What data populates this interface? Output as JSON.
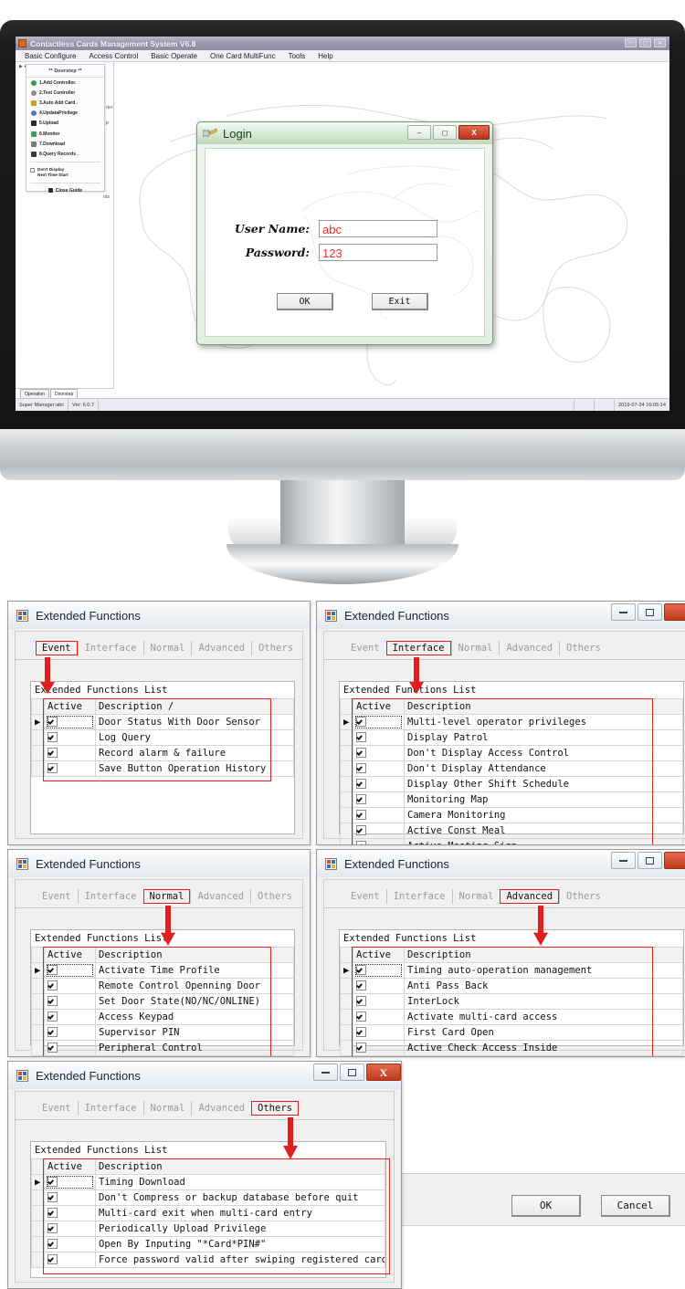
{
  "monitor": {
    "app": {
      "title": "Contactless Cards Management System  V6.8",
      "titlebar_icon": "card-reader-icon",
      "menus": [
        "Basic Configure",
        "Access Control",
        "Basic Operate",
        "One Card MultiFunc",
        "Tools",
        "Help"
      ],
      "window_buttons": [
        "minimize",
        "maximize",
        "close"
      ],
      "guide_panel": {
        "header": "** Doorstep **",
        "items": [
          {
            "label": "1.Add Controller.",
            "icon": "gear-green-icon"
          },
          {
            "label": "2.Test Controller",
            "icon": "magnifier-icon"
          },
          {
            "label": "3.Auto Add Card .",
            "icon": "card-icon"
          },
          {
            "label": "4.UpdataPrivilege",
            "icon": "refresh-icon"
          },
          {
            "label": "5.Upload",
            "icon": "upload-icon"
          },
          {
            "label": "6.Monitor",
            "icon": "monitor-icon"
          },
          {
            "label": "7.Download",
            "icon": "download-icon"
          },
          {
            "label": "8.Query Records .",
            "icon": "binoculars-icon"
          }
        ],
        "checkbox_label": "Don't Display\nNext Time Start",
        "close_label": "Close Guide"
      },
      "ghost_labels": [
        "rter",
        "P",
        "rds"
      ],
      "bottom_tabs": [
        {
          "label": "Operation",
          "selected": false
        },
        {
          "label": "Doorstep",
          "selected": true
        }
      ],
      "statusbar": {
        "user": "Super Manager:abc",
        "version": "Ver: 6.0.7",
        "datetime": "2019-07-24 16:05:14"
      }
    },
    "login_dialog": {
      "title": "Login",
      "titlebar_icon": "key-icon",
      "window_buttons": [
        "minimize",
        "maximize",
        "close"
      ],
      "close_glyph": "X",
      "fields": [
        {
          "label": "User Name:",
          "value": "abc",
          "placeholder": ""
        },
        {
          "label": "Password:",
          "value": "123",
          "placeholder": ""
        }
      ],
      "buttons": [
        {
          "label": "OK",
          "name": "ok-button"
        },
        {
          "label": "Exit",
          "name": "exit-button"
        }
      ]
    }
  },
  "window_title": "Extended Functions",
  "list_title": "Extended Functions List",
  "tab_labels": [
    "Event",
    "Interface",
    "Normal",
    "Advanced",
    "Others"
  ],
  "columns": {
    "active": "Active",
    "description": "Description"
  },
  "accent_red": "#e02020",
  "windows": [
    {
      "id": "event",
      "title": "Extended Functions",
      "active_tab": "Event",
      "desc_header": "Description /",
      "show_window_buttons": false,
      "rows": [
        {
          "active": true,
          "description": "Door Status With Door Sensor",
          "current": true
        },
        {
          "active": true,
          "description": "Log Query",
          "current": false
        },
        {
          "active": true,
          "description": "Record alarm & failure",
          "current": false
        },
        {
          "active": true,
          "description": "Save Button Operation History",
          "current": false
        }
      ]
    },
    {
      "id": "interface",
      "title": "Extended Functions",
      "active_tab": "Interface",
      "desc_header": "Description",
      "show_window_buttons": true,
      "rows": [
        {
          "active": true,
          "description": "Multi-level operator privileges",
          "current": true
        },
        {
          "active": true,
          "description": "Display Patrol",
          "current": false
        },
        {
          "active": true,
          "description": "Don't Display Access Control",
          "current": false
        },
        {
          "active": true,
          "description": "Don't Display Attendance",
          "current": false
        },
        {
          "active": true,
          "description": "Display Other Shift Schedule",
          "current": false
        },
        {
          "active": true,
          "description": "Monitoring Map",
          "current": false
        },
        {
          "active": true,
          "description": "Camera Monitoring",
          "current": false
        },
        {
          "active": true,
          "description": "Active Const Meal",
          "current": false
        },
        {
          "active": true,
          "description": "Active Meeting Sign",
          "current": false
        }
      ]
    },
    {
      "id": "normal",
      "title": "Extended Functions",
      "active_tab": "Normal",
      "desc_header": "Description",
      "show_window_buttons": false,
      "rows": [
        {
          "active": true,
          "description": "Activate Time Profile",
          "current": true
        },
        {
          "active": true,
          "description": "Remote Control Openning Door",
          "current": false
        },
        {
          "active": true,
          "description": "Set Door State(NO/NC/ONLINE)",
          "current": false
        },
        {
          "active": true,
          "description": "Access Keypad",
          "current": false
        },
        {
          "active": true,
          "description": "Supervisor PIN",
          "current": false
        },
        {
          "active": true,
          "description": "Peripheral Control",
          "current": false
        }
      ]
    },
    {
      "id": "advanced",
      "title": "Extended Functions",
      "active_tab": "Advanced",
      "desc_header": "Description",
      "show_window_buttons": true,
      "rows": [
        {
          "active": true,
          "description": "Timing auto-operation management",
          "current": true
        },
        {
          "active": true,
          "description": "Anti Pass Back",
          "current": false
        },
        {
          "active": true,
          "description": "InterLock",
          "current": false
        },
        {
          "active": true,
          "description": "Activate multi-card access",
          "current": false
        },
        {
          "active": true,
          "description": "First Card Open",
          "current": false
        },
        {
          "active": true,
          "description": "Active Check Access Inside",
          "current": false
        }
      ]
    },
    {
      "id": "others",
      "title": "Extended Functions",
      "active_tab": "Others",
      "desc_header": "Description",
      "show_window_buttons": true,
      "close_glyph": "X",
      "rows": [
        {
          "active": true,
          "description": "Timing Download",
          "current": true
        },
        {
          "active": true,
          "description": "Don't Compress or backup database before quit",
          "current": false
        },
        {
          "active": true,
          "description": "Multi-card exit when multi-card entry",
          "current": false
        },
        {
          "active": true,
          "description": "Periodically Upload Privilege",
          "current": false
        },
        {
          "active": true,
          "description": "Open By Inputing \"*Card*PIN#\"",
          "current": false
        },
        {
          "active": true,
          "description": "Force password valid after swiping registered card",
          "current": false
        }
      ]
    }
  ],
  "dialog_footer": {
    "ok_label": "OK",
    "cancel_label": "Cancel"
  }
}
